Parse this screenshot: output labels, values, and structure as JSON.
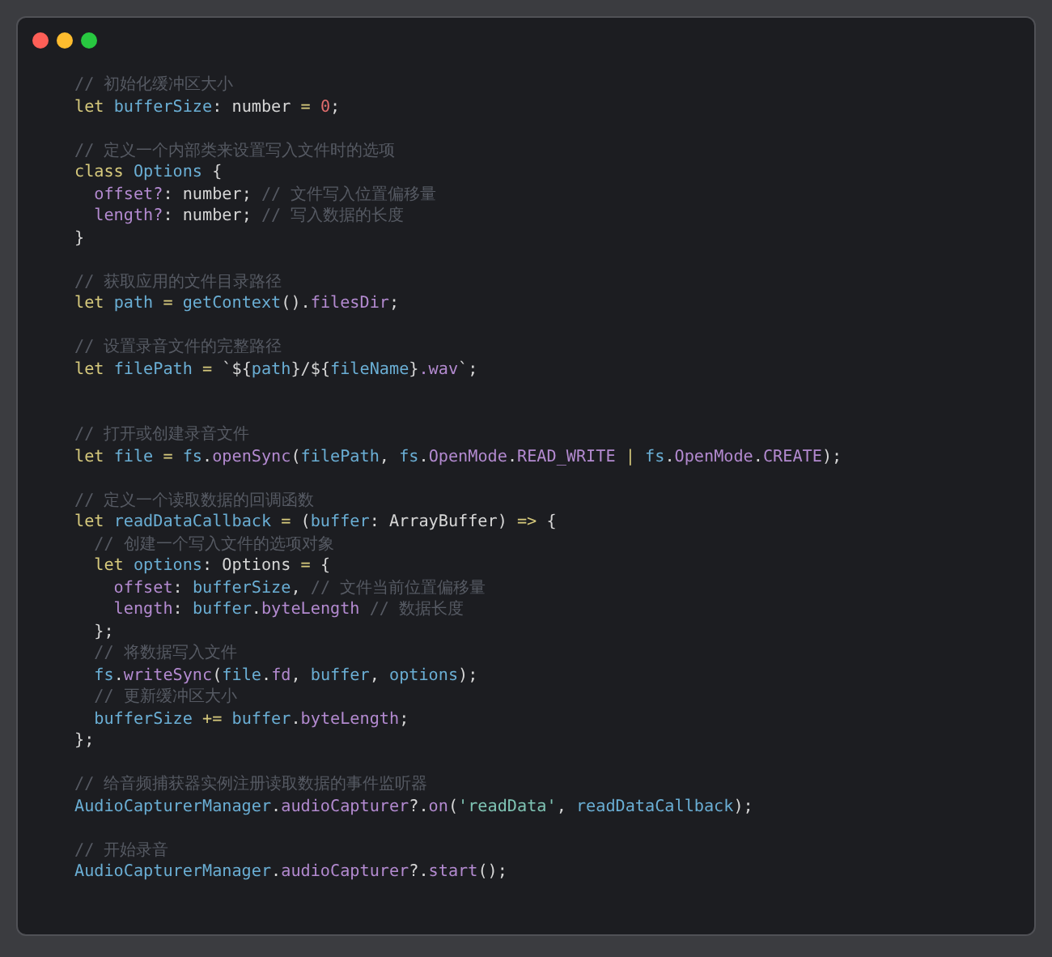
{
  "code_lines": [
    {
      "kind": "code",
      "tokens": [
        {
          "kind": "comment",
          "text": "// 初始化缓冲区大小"
        }
      ]
    },
    {
      "kind": "code",
      "tokens": [
        {
          "kind": "keyword",
          "text": "let "
        },
        {
          "kind": "variable",
          "text": "bufferSize"
        },
        {
          "kind": "plain",
          "text": ": number "
        },
        {
          "kind": "operator",
          "text": "= "
        },
        {
          "kind": "number",
          "text": "0"
        },
        {
          "kind": "plain",
          "text": ";"
        }
      ]
    },
    {
      "kind": "blank"
    },
    {
      "kind": "code",
      "tokens": [
        {
          "kind": "comment",
          "text": "// 定义一个内部类来设置写入文件时的选项"
        }
      ]
    },
    {
      "kind": "code",
      "tokens": [
        {
          "kind": "keyword",
          "text": "class "
        },
        {
          "kind": "variable",
          "text": "Options"
        },
        {
          "kind": "plain",
          "text": " {"
        }
      ]
    },
    {
      "kind": "code",
      "tokens": [
        {
          "kind": "property",
          "text": "  offset?"
        },
        {
          "kind": "plain",
          "text": ": number; "
        },
        {
          "kind": "comment",
          "text": "// 文件写入位置偏移量"
        }
      ]
    },
    {
      "kind": "code",
      "tokens": [
        {
          "kind": "property",
          "text": "  length?"
        },
        {
          "kind": "plain",
          "text": ": number; "
        },
        {
          "kind": "comment",
          "text": "// 写入数据的长度"
        }
      ]
    },
    {
      "kind": "code",
      "tokens": [
        {
          "kind": "plain",
          "text": "}"
        }
      ]
    },
    {
      "kind": "blank"
    },
    {
      "kind": "code",
      "tokens": [
        {
          "kind": "comment",
          "text": "// 获取应用的文件目录路径"
        }
      ]
    },
    {
      "kind": "code",
      "tokens": [
        {
          "kind": "keyword",
          "text": "let "
        },
        {
          "kind": "variable",
          "text": "path "
        },
        {
          "kind": "operator",
          "text": "= "
        },
        {
          "kind": "variable",
          "text": "getContext"
        },
        {
          "kind": "plain",
          "text": "()."
        },
        {
          "kind": "property",
          "text": "filesDir"
        },
        {
          "kind": "plain",
          "text": ";"
        }
      ]
    },
    {
      "kind": "blank"
    },
    {
      "kind": "code",
      "tokens": [
        {
          "kind": "comment",
          "text": "// 设置录音文件的完整路径"
        }
      ]
    },
    {
      "kind": "code",
      "tokens": [
        {
          "kind": "keyword",
          "text": "let "
        },
        {
          "kind": "variable",
          "text": "filePath "
        },
        {
          "kind": "operator",
          "text": "= "
        },
        {
          "kind": "plain",
          "text": "`${"
        },
        {
          "kind": "variable",
          "text": "path"
        },
        {
          "kind": "plain",
          "text": "}/${"
        },
        {
          "kind": "variable",
          "text": "fileName"
        },
        {
          "kind": "plain",
          "text": "}"
        },
        {
          "kind": "property",
          "text": ".wav"
        },
        {
          "kind": "plain",
          "text": "`;"
        }
      ]
    },
    {
      "kind": "blank"
    },
    {
      "kind": "blank"
    },
    {
      "kind": "code",
      "tokens": [
        {
          "kind": "comment",
          "text": "// 打开或创建录音文件"
        }
      ]
    },
    {
      "kind": "code",
      "tokens": [
        {
          "kind": "keyword",
          "text": "let "
        },
        {
          "kind": "variable",
          "text": "file "
        },
        {
          "kind": "operator",
          "text": "= "
        },
        {
          "kind": "variable",
          "text": "fs"
        },
        {
          "kind": "plain",
          "text": "."
        },
        {
          "kind": "property",
          "text": "openSync"
        },
        {
          "kind": "plain",
          "text": "("
        },
        {
          "kind": "variable",
          "text": "filePath"
        },
        {
          "kind": "plain",
          "text": ", "
        },
        {
          "kind": "variable",
          "text": "fs"
        },
        {
          "kind": "plain",
          "text": "."
        },
        {
          "kind": "property",
          "text": "OpenMode"
        },
        {
          "kind": "plain",
          "text": "."
        },
        {
          "kind": "property",
          "text": "READ_WRITE "
        },
        {
          "kind": "operator",
          "text": "| "
        },
        {
          "kind": "variable",
          "text": "fs"
        },
        {
          "kind": "plain",
          "text": "."
        },
        {
          "kind": "property",
          "text": "OpenMode"
        },
        {
          "kind": "plain",
          "text": "."
        },
        {
          "kind": "property",
          "text": "CREATE"
        },
        {
          "kind": "plain",
          "text": ");"
        }
      ]
    },
    {
      "kind": "blank"
    },
    {
      "kind": "code",
      "tokens": [
        {
          "kind": "comment",
          "text": "// 定义一个读取数据的回调函数"
        }
      ]
    },
    {
      "kind": "code",
      "tokens": [
        {
          "kind": "keyword",
          "text": "let "
        },
        {
          "kind": "variable",
          "text": "readDataCallback "
        },
        {
          "kind": "operator",
          "text": "= "
        },
        {
          "kind": "plain",
          "text": "("
        },
        {
          "kind": "variable",
          "text": "buffer"
        },
        {
          "kind": "plain",
          "text": ": ArrayBuffer) "
        },
        {
          "kind": "operator",
          "text": "=> "
        },
        {
          "kind": "plain",
          "text": "{"
        }
      ]
    },
    {
      "kind": "code",
      "tokens": [
        {
          "kind": "comment",
          "text": "  // 创建一个写入文件的选项对象"
        }
      ]
    },
    {
      "kind": "code",
      "tokens": [
        {
          "kind": "keyword",
          "text": "  let "
        },
        {
          "kind": "variable",
          "text": "options"
        },
        {
          "kind": "plain",
          "text": ": Options "
        },
        {
          "kind": "operator",
          "text": "= "
        },
        {
          "kind": "plain",
          "text": "{"
        }
      ]
    },
    {
      "kind": "code",
      "tokens": [
        {
          "kind": "property",
          "text": "    offset"
        },
        {
          "kind": "plain",
          "text": ": "
        },
        {
          "kind": "variable",
          "text": "bufferSize"
        },
        {
          "kind": "plain",
          "text": ", "
        },
        {
          "kind": "comment",
          "text": "// 文件当前位置偏移量"
        }
      ]
    },
    {
      "kind": "code",
      "tokens": [
        {
          "kind": "property",
          "text": "    length"
        },
        {
          "kind": "plain",
          "text": ": "
        },
        {
          "kind": "variable",
          "text": "buffer"
        },
        {
          "kind": "plain",
          "text": "."
        },
        {
          "kind": "property",
          "text": "byteLength "
        },
        {
          "kind": "comment",
          "text": "// 数据长度"
        }
      ]
    },
    {
      "kind": "code",
      "tokens": [
        {
          "kind": "plain",
          "text": "  };"
        }
      ]
    },
    {
      "kind": "code",
      "tokens": [
        {
          "kind": "comment",
          "text": "  // 将数据写入文件"
        }
      ]
    },
    {
      "kind": "code",
      "tokens": [
        {
          "kind": "variable",
          "text": "  fs"
        },
        {
          "kind": "plain",
          "text": "."
        },
        {
          "kind": "property",
          "text": "writeSync"
        },
        {
          "kind": "plain",
          "text": "("
        },
        {
          "kind": "variable",
          "text": "file"
        },
        {
          "kind": "plain",
          "text": "."
        },
        {
          "kind": "property",
          "text": "fd"
        },
        {
          "kind": "plain",
          "text": ", "
        },
        {
          "kind": "variable",
          "text": "buffer"
        },
        {
          "kind": "plain",
          "text": ", "
        },
        {
          "kind": "variable",
          "text": "options"
        },
        {
          "kind": "plain",
          "text": ");"
        }
      ]
    },
    {
      "kind": "code",
      "tokens": [
        {
          "kind": "comment",
          "text": "  // 更新缓冲区大小"
        }
      ]
    },
    {
      "kind": "code",
      "tokens": [
        {
          "kind": "variable",
          "text": "  bufferSize "
        },
        {
          "kind": "operator",
          "text": "+= "
        },
        {
          "kind": "variable",
          "text": "buffer"
        },
        {
          "kind": "plain",
          "text": "."
        },
        {
          "kind": "property",
          "text": "byteLength"
        },
        {
          "kind": "plain",
          "text": ";"
        }
      ]
    },
    {
      "kind": "code",
      "tokens": [
        {
          "kind": "plain",
          "text": "};"
        }
      ]
    },
    {
      "kind": "blank"
    },
    {
      "kind": "code",
      "tokens": [
        {
          "kind": "comment",
          "text": "// 给音频捕获器实例注册读取数据的事件监听器"
        }
      ]
    },
    {
      "kind": "code",
      "tokens": [
        {
          "kind": "variable",
          "text": "AudioCapturerManager"
        },
        {
          "kind": "plain",
          "text": "."
        },
        {
          "kind": "property",
          "text": "audioCapturer"
        },
        {
          "kind": "plain",
          "text": "?."
        },
        {
          "kind": "property",
          "text": "on"
        },
        {
          "kind": "plain",
          "text": "("
        },
        {
          "kind": "string",
          "text": "'readData'"
        },
        {
          "kind": "plain",
          "text": ", "
        },
        {
          "kind": "variable",
          "text": "readDataCallback"
        },
        {
          "kind": "plain",
          "text": ");"
        }
      ]
    },
    {
      "kind": "blank"
    },
    {
      "kind": "code",
      "tokens": [
        {
          "kind": "comment",
          "text": "// 开始录音"
        }
      ]
    },
    {
      "kind": "code",
      "tokens": [
        {
          "kind": "variable",
          "text": "AudioCapturerManager"
        },
        {
          "kind": "plain",
          "text": "."
        },
        {
          "kind": "property",
          "text": "audioCapturer"
        },
        {
          "kind": "plain",
          "text": "?."
        },
        {
          "kind": "property",
          "text": "start"
        },
        {
          "kind": "plain",
          "text": "();"
        }
      ]
    }
  ]
}
